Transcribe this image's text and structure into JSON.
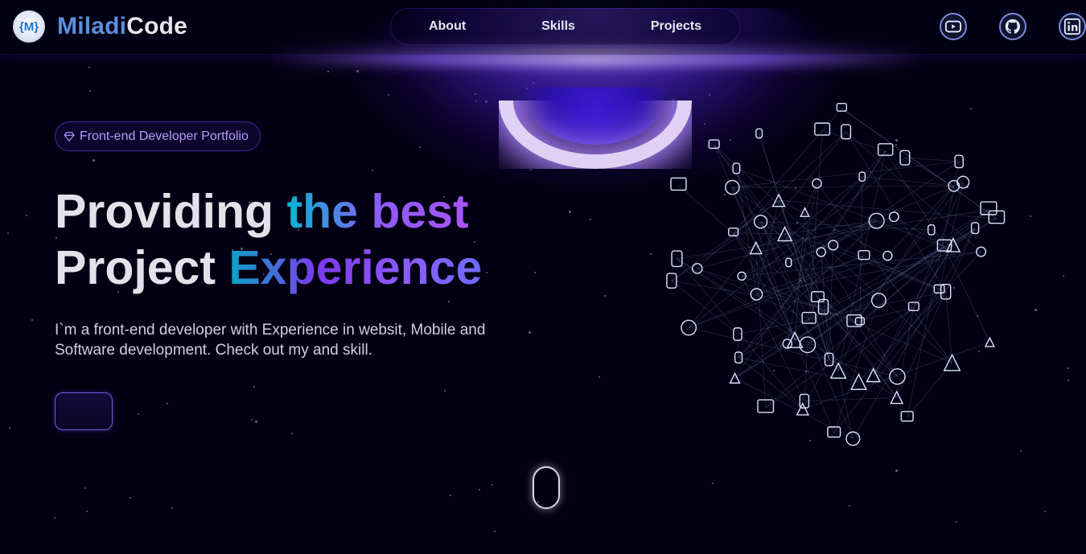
{
  "header": {
    "logo_badge": "{M}",
    "brand_part1": "Miladi",
    "brand_part2": "Code",
    "nav": [
      "About",
      "Skills",
      "Projects"
    ],
    "social": [
      "youtube-icon",
      "github-icon",
      "linkedin-icon"
    ]
  },
  "hero": {
    "badge_label": "Front-end Developer Portfolio",
    "title_line1_plain": "Providing ",
    "title_line1_grad": "the best",
    "title_line2_plain": "Project ",
    "title_line2_grad": "Experience",
    "description": "I`m a front-end developer with Experience in websit, Mobile and Software development. Check out my and skill.",
    "cta_label": ""
  },
  "colors": {
    "background": "#030014",
    "accent": "#7042f8",
    "brand_blue": "#5b8fd9",
    "gradient_start": "#06b6d4",
    "gradient_end": "#a855f7"
  }
}
